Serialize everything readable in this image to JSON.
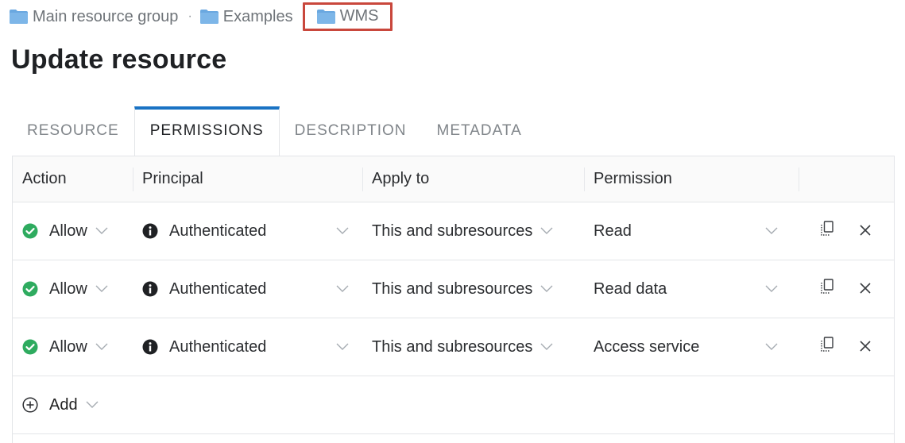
{
  "breadcrumb": [
    {
      "label": "Main resource group",
      "icon": "folder-icon"
    },
    {
      "label": "Examples",
      "icon": "folder-icon"
    },
    {
      "label": "WMS",
      "icon": "folder-icon",
      "highlighted": true
    }
  ],
  "breadcrumb_separator": "·",
  "page_title": "Update resource",
  "tabs": [
    {
      "label": "RESOURCE",
      "active": false
    },
    {
      "label": "PERMISSIONS",
      "active": true
    },
    {
      "label": "DESCRIPTION",
      "active": false
    },
    {
      "label": "METADATA",
      "active": false
    }
  ],
  "table": {
    "headers": {
      "action": "Action",
      "principal": "Principal",
      "apply_to": "Apply to",
      "permission": "Permission"
    },
    "rows": [
      {
        "action": "Allow",
        "principal": "Authenticated",
        "apply_to": "This and subresources",
        "permission": "Read"
      },
      {
        "action": "Allow",
        "principal": "Authenticated",
        "apply_to": "This and subresources",
        "permission": "Read data"
      },
      {
        "action": "Allow",
        "principal": "Authenticated",
        "apply_to": "This and subresources",
        "permission": "Access service"
      }
    ],
    "add_label": "Add"
  },
  "colors": {
    "accent": "#1a73c4",
    "allow": "#2eab5f",
    "highlight": "#c9473c",
    "folder": "#6aa8e0"
  }
}
